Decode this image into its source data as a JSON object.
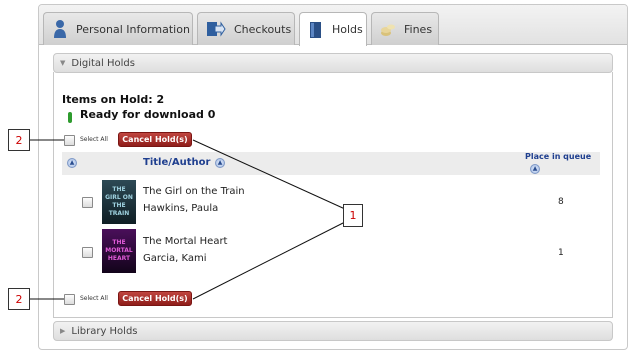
{
  "tabs": [
    {
      "label": "Personal Information",
      "icon": "person-icon"
    },
    {
      "label": "Checkouts",
      "icon": "checkout-arrow-icon"
    },
    {
      "label": "Holds",
      "icon": "book-icon"
    },
    {
      "label": "Fines",
      "icon": "coins-icon"
    }
  ],
  "active_tab": "Holds",
  "digital_holds": {
    "panel_title": "Digital Holds",
    "items_on_hold": "Items on Hold: 2",
    "ready_text": "Ready for download 0",
    "select_all": "Select All",
    "cancel_button": "Cancel Hold(s)",
    "columns": {
      "title_author": "Title/Author",
      "place_in_queue": "Place in queue"
    },
    "rows": [
      {
        "title": "The Girl on the Train",
        "author": "Hawkins, Paula",
        "queue": "8",
        "cover_text": "THE GIRL ON THE TRAIN"
      },
      {
        "title": "The Mortal Heart",
        "author": "Garcia, Kami",
        "queue": "1",
        "cover_text": "THE MORTAL HEART"
      }
    ]
  },
  "library_holds": {
    "panel_title": "Library Holds"
  },
  "callouts": {
    "one": "1",
    "two_top": "2",
    "two_bottom": "2"
  },
  "colors": {
    "accent_red": "#a3282a",
    "link_blue": "#1f3f8f",
    "ready_green": "#2e9b2e"
  }
}
